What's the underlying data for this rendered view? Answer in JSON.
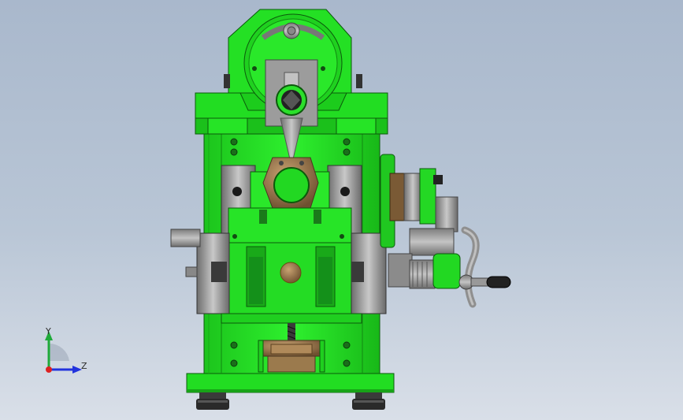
{
  "view": {
    "background_top": "#a9b8cc",
    "background_bottom": "#d9dfe8",
    "model_color": "#22dd22",
    "model_shadow": "#17a317",
    "steel_color": "#a0a0a0",
    "bronze_color": "#8a6a4a"
  },
  "triad": {
    "y_label": "Y",
    "z_label": "Z",
    "y_color": "#1faa3a",
    "z_color": "#2233dd",
    "x_color": "#dd2222"
  }
}
